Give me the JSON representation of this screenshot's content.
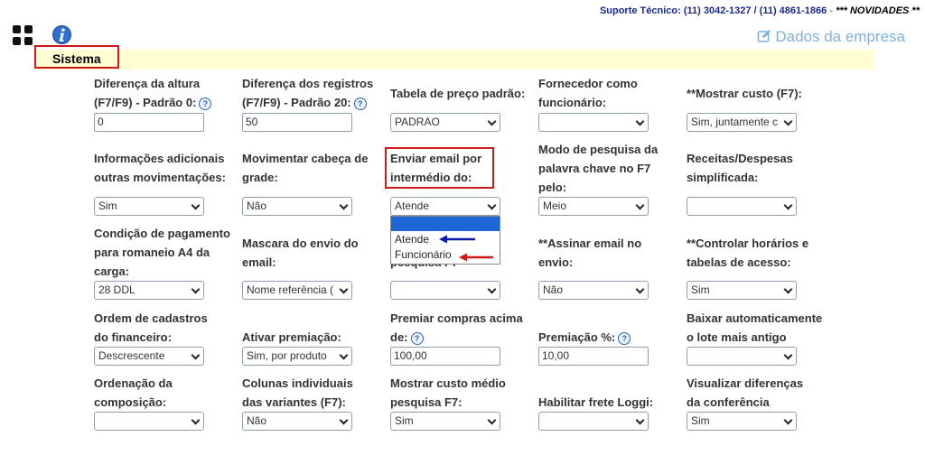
{
  "header": {
    "support_label": "Suporte Técnico:",
    "phone1": "(11) 3042-1327",
    "separator": "/",
    "phone2": "(11) 4861-1866",
    "dash": "-",
    "news": "*** NOVIDADES **",
    "company_link": "Dados da empresa",
    "section": "Sistema",
    "icons": [
      "grid-icon",
      "info-icon",
      "edit-icon"
    ]
  },
  "fields": [
    {
      "label1": "Diferença da altura",
      "label2": "(F7/F9) - Padrão 0:",
      "help": "?",
      "value": "0"
    },
    {
      "label1": "Diferença dos registros",
      "label2": "(F7/F9) - Padrão 20:",
      "help": "?",
      "value": "50"
    },
    {
      "label1": "Tabela de preço padrão:",
      "value": "PADRAO"
    },
    {
      "label1": "Fornecedor como",
      "label2": "funcionário:",
      "value": ""
    },
    {
      "label1": "**Mostrar custo (F7):",
      "value": "Sim, juntamente c"
    },
    {
      "label1": "Informações adicionais",
      "label2": "outras movimentações:",
      "value": "Sim"
    },
    {
      "label1": "Movimentar cabeça de",
      "label2": "grade:",
      "value": "Não"
    },
    {
      "label1": "Enviar email por",
      "label2": "intermédio do:",
      "value": "Atende"
    },
    {
      "label1": "Modo de pesquisa da",
      "label2": "palavra chave no F7",
      "label3": "pelo:",
      "value": "Meio"
    },
    {
      "label1": "Receitas/Despesas",
      "label2": "simplificada:",
      "value": ""
    },
    {
      "label1": "Condição de pagamento",
      "label2": "para romaneio A4 da",
      "label3": "carga:",
      "value": "28 DDL"
    },
    {
      "label1": "Mascara do envio do",
      "label2": "email:",
      "value": "Nome referência ("
    },
    {
      "label1": "pesquisa F7",
      "value": ""
    },
    {
      "label1": "**Assinar email no",
      "label2": "envio:",
      "value": "Não"
    },
    {
      "label1": "**Controlar horários e",
      "label2": "tabelas de acesso:",
      "value": "Sim"
    },
    {
      "label1": "Ordem de cadastros",
      "label2": "do financeiro:",
      "value": "Descrescente"
    },
    {
      "label1": "Ativar premiação:",
      "value": "Sim, por produto"
    },
    {
      "label1": "Premiar compras acima",
      "label2": "de:",
      "help": "?",
      "value": "100,00"
    },
    {
      "label1": "Premiação %:",
      "help": "?",
      "value": "10,00"
    },
    {
      "label1": "Baixar automaticamente",
      "label2": "o lote mais antigo",
      "value": ""
    },
    {
      "label1": "Ordenação da",
      "label2": "composição:",
      "value": ""
    },
    {
      "label1": "Colunas individuais",
      "label2": "das variantes (F7):",
      "value": "Não"
    },
    {
      "label1": "Mostrar custo médio",
      "label2": "pesquisa F7:",
      "value": "Sim"
    },
    {
      "label1": "Habilitar frete Loggi:",
      "value": ""
    },
    {
      "label1": "Visualizar diferenças",
      "label2": "da conferência",
      "value": "Sim"
    }
  ],
  "dropdown": {
    "options": [
      "",
      "Atende",
      "Funcionário"
    ],
    "arrow_colors": [
      "#0a1aa8",
      "#d01818"
    ]
  },
  "colors": {
    "support_text": "#1a2a8c",
    "company_link": "#7fb2d9",
    "section_bar": "#ffffd2",
    "highlight": "#d01818",
    "dropdown_selected": "#1e66d6"
  }
}
